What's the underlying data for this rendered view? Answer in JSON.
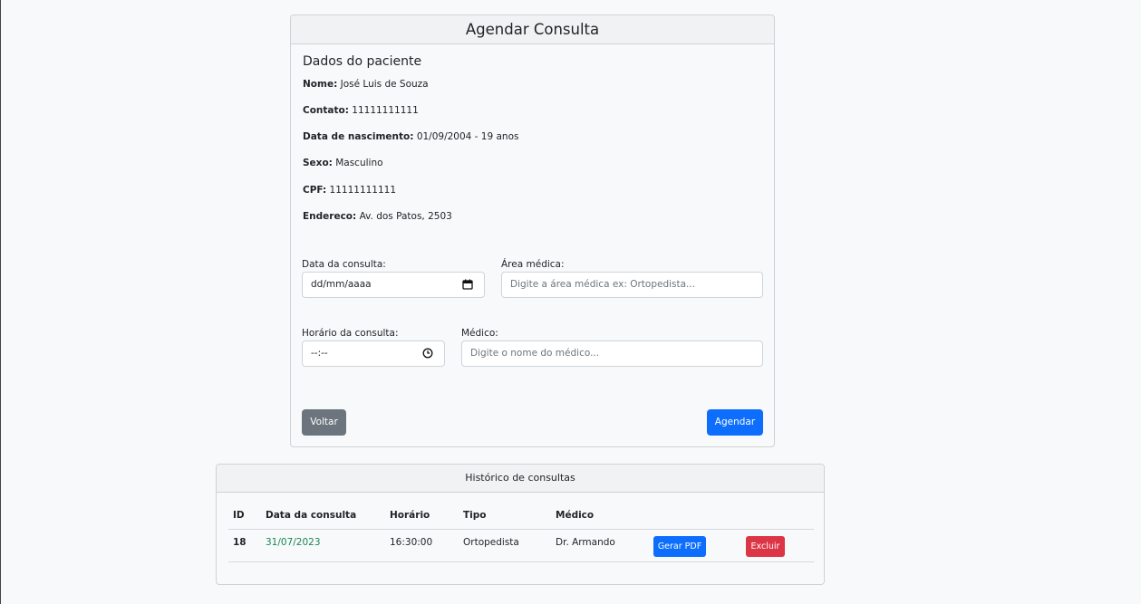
{
  "schedule": {
    "title": "Agendar Consulta",
    "section_title": "Dados do paciente",
    "patient": [
      {
        "label": "Nome:",
        "value": "José Luis de Souza"
      },
      {
        "label": "Contato:",
        "value": "11111111111"
      },
      {
        "label": "Data de nascimento:",
        "value": "01/09/2004 - 19 anos"
      },
      {
        "label": "Sexo:",
        "value": "Masculino"
      },
      {
        "label": "CPF:",
        "value": "11111111111"
      },
      {
        "label": "Endereco:",
        "value": "Av. dos Patos, 2503"
      }
    ],
    "fields": {
      "date_label": "Data da consulta:",
      "date_value": "dd/mm/aaaa",
      "area_label": "Área médica:",
      "area_placeholder": "Digite a área médica ex: Ortopedista...",
      "time_label": "Horário da consulta:",
      "time_value": "--:--",
      "doctor_label": "Médico:",
      "doctor_placeholder": "Digite o nome do médico..."
    },
    "buttons": {
      "back": "Voltar",
      "schedule": "Agendar"
    }
  },
  "history": {
    "title": "Histórico de consultas",
    "columns": [
      "ID",
      "Data da consulta",
      "Horário",
      "Tipo",
      "Médico"
    ],
    "rows": [
      {
        "id": "18",
        "date": "31/07/2023",
        "time": "16:30:00",
        "type": "Ortopedista",
        "doctor": "Dr. Armando",
        "pdf_label": "Gerar PDF",
        "delete_label": "Excluir"
      }
    ]
  },
  "colors": {
    "primary": "#0d6efd",
    "secondary": "#6c757d",
    "danger": "#dc3545",
    "date_green": "#198754"
  }
}
